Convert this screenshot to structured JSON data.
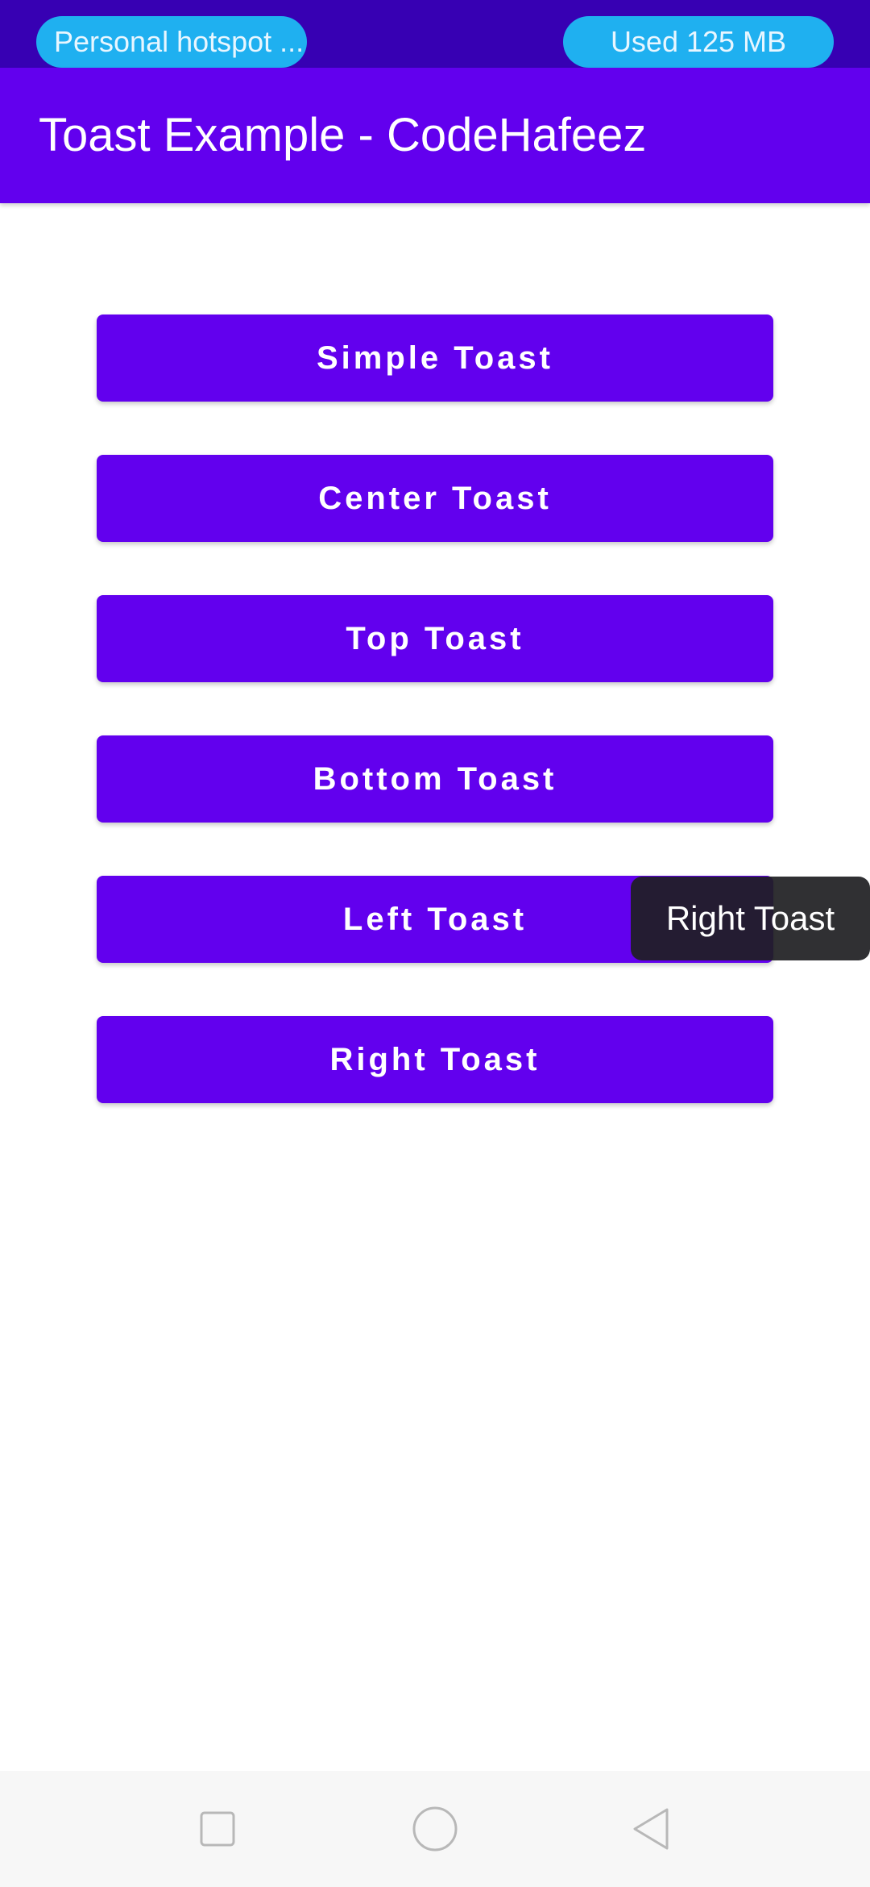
{
  "status_bar": {
    "hotspot_label": "Personal hotspot ...",
    "data_usage_label": "Used  125 MB"
  },
  "app_bar": {
    "title": "Toast Example - CodeHafeez"
  },
  "buttons": [
    {
      "label": "Simple Toast"
    },
    {
      "label": "Center Toast"
    },
    {
      "label": "Top Toast"
    },
    {
      "label": "Bottom Toast"
    },
    {
      "label": "Left Toast"
    },
    {
      "label": "Right Toast"
    }
  ],
  "toast": {
    "message": "Right Toast"
  },
  "navigation": {
    "recents_icon": "square-icon",
    "home_icon": "circle-icon",
    "back_icon": "triangle-back-icon"
  },
  "colors": {
    "status_bar": "#3700b3",
    "primary": "#6200ee",
    "pill": "#1fb0f0",
    "toast_bg": "#1e1e22",
    "nav_bar": "#f7f7f7"
  }
}
